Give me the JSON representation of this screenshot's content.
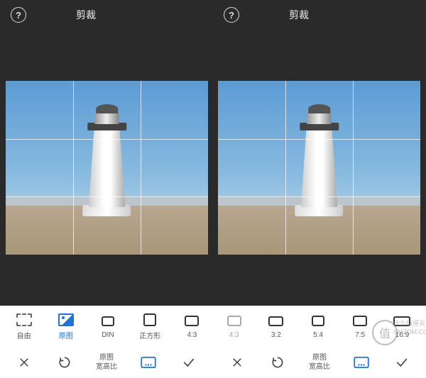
{
  "header": {
    "title_left": "剪裁",
    "title_right": "剪裁"
  },
  "ratios": {
    "free": "自由",
    "original": "原图",
    "din": "DIN",
    "square": "正方形",
    "r43": "4:3",
    "r43b": "4:3",
    "r32": "3:2",
    "r54": "5:4",
    "r75": "7:5",
    "r169": "16:9"
  },
  "bottom": {
    "aspect_line1": "原图",
    "aspect_line2": "宽高比"
  },
  "watermark": {
    "char": "值",
    "line1": "什么值得买",
    "line2": "SMZDM.COM"
  }
}
